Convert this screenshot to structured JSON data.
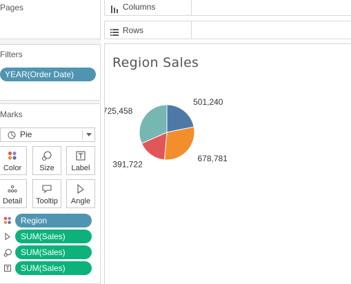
{
  "pages_card": {
    "title": "Pages"
  },
  "filters_card": {
    "title": "Filters",
    "filters": [
      {
        "label": "YEAR(Order Date)"
      }
    ]
  },
  "marks_card": {
    "title": "Marks",
    "mark_type": "Pie",
    "buttons": [
      {
        "label": "Color",
        "icon": "color-dots-icon"
      },
      {
        "label": "Size",
        "icon": "size-icon"
      },
      {
        "label": "Label",
        "icon": "label-icon"
      },
      {
        "label": "Detail",
        "icon": "detail-icon"
      },
      {
        "label": "Tooltip",
        "icon": "tooltip-icon"
      },
      {
        "label": "Angle",
        "icon": "angle-icon"
      }
    ],
    "fields": [
      {
        "icon": "color-dots-icon",
        "label": "Region",
        "kind": "dimension"
      },
      {
        "icon": "angle-icon",
        "label": "SUM(Sales)",
        "kind": "measure"
      },
      {
        "icon": "size-icon",
        "label": "SUM(Sales)",
        "kind": "measure"
      },
      {
        "icon": "label-icon",
        "label": "SUM(Sales)",
        "kind": "measure"
      }
    ]
  },
  "shelves": {
    "columns_label": "Columns",
    "rows_label": "Rows"
  },
  "colors": {
    "pill_blue": "#4f95b1",
    "pill_green": "#0db27b"
  },
  "chart_data": {
    "type": "pie",
    "title": "Region Sales",
    "slices": [
      {
        "value": 501240,
        "label": "501,240",
        "color": "#4e79a7"
      },
      {
        "value": 678781,
        "label": "678,781",
        "color": "#f28e2b"
      },
      {
        "value": 391722,
        "label": "391,722",
        "color": "#e15759"
      },
      {
        "value": 725458,
        "label": "725,458",
        "color": "#76b7b2"
      }
    ]
  }
}
